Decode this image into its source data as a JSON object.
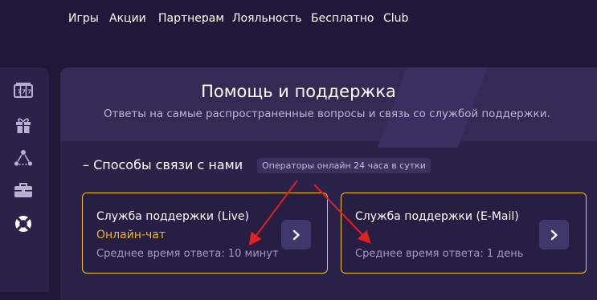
{
  "nav": {
    "items": [
      {
        "label": "Игры"
      },
      {
        "label": "Акции"
      },
      {
        "label": "Партнерам"
      },
      {
        "label": "Лояльность"
      },
      {
        "label": "Бесплатно"
      },
      {
        "label": "Club"
      }
    ]
  },
  "sidebar": {
    "items": [
      {
        "icon": "slot-machine-icon"
      },
      {
        "icon": "gift-icon"
      },
      {
        "icon": "referral-network-icon"
      },
      {
        "icon": "briefcase-icon"
      },
      {
        "icon": "lifebuoy-icon",
        "active": true
      }
    ]
  },
  "page": {
    "title": "Помощь и поддержка",
    "subtitle": "Ответы на самые распространенные вопросы и связь со службой поддержки."
  },
  "contact": {
    "heading": "– Способы связи с нами",
    "badge": "Операторы онлайн 24 часа в сутки",
    "cards": [
      {
        "title": "Служба поддержки (Live)",
        "accent": "Онлайн-чат",
        "meta": "Среднее время ответа: 10 минут",
        "button_icon": "chevron-right-icon"
      },
      {
        "title": "Служба поддержки (E-Mail)",
        "meta": "Среднее время ответа: 1 день",
        "button_icon": "chevron-right-icon"
      }
    ]
  },
  "colors": {
    "background": "#1f1838",
    "panel": "#2b2249",
    "card_border": "#f2c230",
    "accent_text": "#f5b325",
    "annotation_arrow": "#e0211f"
  }
}
